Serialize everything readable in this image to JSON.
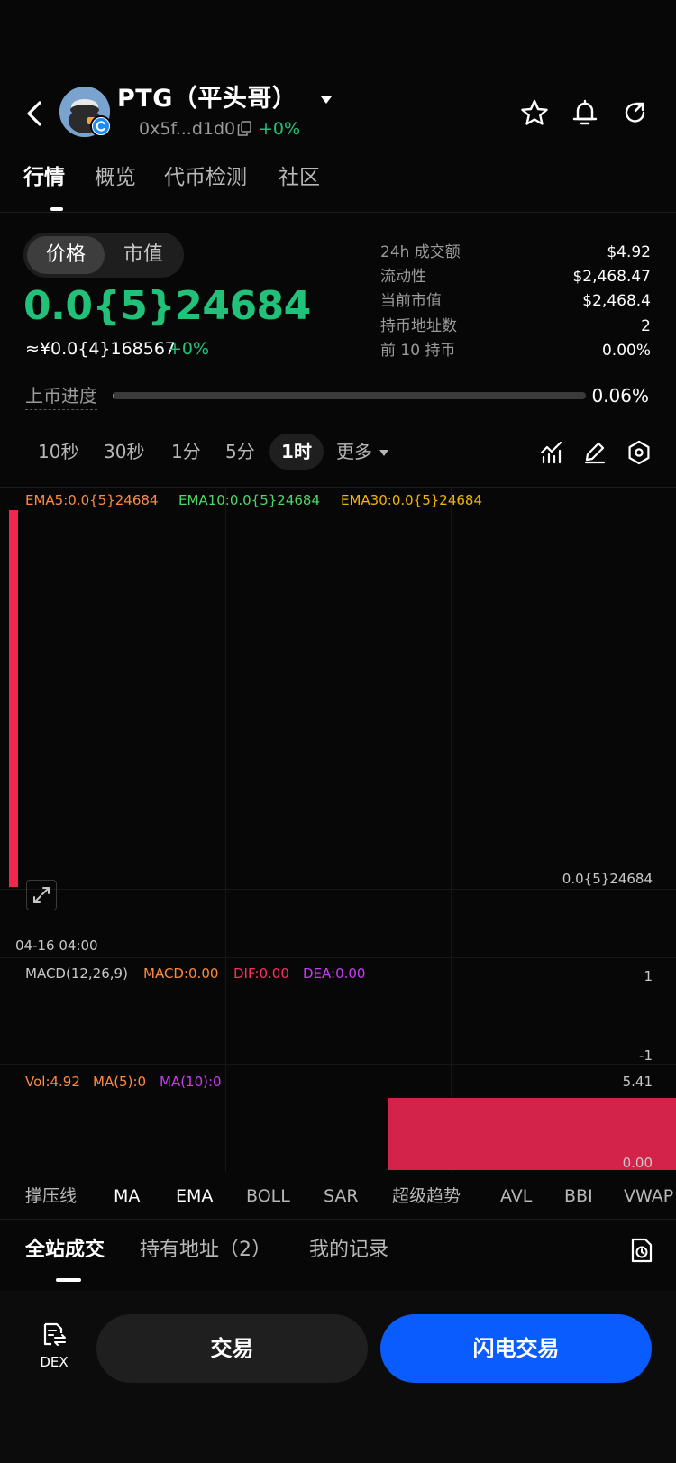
{
  "header": {
    "token_name": "PTG（平头哥）",
    "address": "0x5f...d1d0",
    "address_change": "+0%",
    "icons": [
      "back-icon",
      "avatar",
      "caret-down-icon",
      "copy-icon",
      "star-icon",
      "bell-icon",
      "share-icon"
    ]
  },
  "main_tabs": [
    {
      "label": "行情",
      "active": true
    },
    {
      "label": "概览",
      "active": false
    },
    {
      "label": "代币检测",
      "active": false
    },
    {
      "label": "社区",
      "active": false
    }
  ],
  "price_toggle": {
    "active": "价格",
    "inactive": "市值"
  },
  "price": {
    "value": "0.0{5}24684",
    "cny": "≈¥0.0{4}168567",
    "change": "+0%"
  },
  "stats": [
    {
      "label": "24h 成交额",
      "value": "$4.92"
    },
    {
      "label": "流动性",
      "value": "$2,468.47"
    },
    {
      "label": "当前市值",
      "value": "$2,468.4"
    },
    {
      "label": "持币地址数",
      "value": "2"
    },
    {
      "label": "前 10 持币",
      "value": "0.00%"
    }
  ],
  "progress": {
    "label": "上币进度",
    "value": "0.06%",
    "fraction": 0.0006
  },
  "intervals": {
    "options": [
      "10秒",
      "30秒",
      "1分",
      "5分"
    ],
    "active": "1时",
    "more": "更多"
  },
  "chart": {
    "ema5": "EMA5:0.0{5}24684",
    "ema10": "EMA10:0.0{5}24684",
    "ema30": "EMA30:0.0{5}24684",
    "price_tag": "0.0{5}24684",
    "time": "04-16 04:00",
    "macd": {
      "name": "MACD(12,26,9)",
      "macd": "MACD:0.00",
      "dif": "DIF:0.00",
      "dea": "DEA:0.00",
      "axis_top": "1",
      "axis_bottom": "-1"
    },
    "volume": {
      "vol": "Vol:4.92",
      "ma5": "MA(5):0",
      "ma10": "MA(10):0",
      "axis_top": "5.41",
      "axis_bottom": "0.00"
    }
  },
  "indicators": [
    "撑压线",
    "MA",
    "EMA",
    "BOLL",
    "SAR",
    "超级趋势",
    "AVL",
    "BBI",
    "VWAP"
  ],
  "bottom_tabs": [
    {
      "label": "全站成交",
      "active": true
    },
    {
      "label": "持有地址（2）",
      "active": false
    },
    {
      "label": "我的记录",
      "active": false
    }
  ],
  "footer": {
    "dex_label": "DEX",
    "trade_label": "交易",
    "flash_trade_label": "闪电交易"
  },
  "colors": {
    "up": "#21c17a",
    "candle_red": "#f0284f",
    "primary_blue": "#0a5cff",
    "ema5": "#ff8a3d",
    "ema10": "#4cd964",
    "ema30": "#f5b400",
    "macd": "#ff8a3d",
    "dif": "#ff2e63",
    "dea": "#c93cf5",
    "ma10": "#c93cf5"
  }
}
